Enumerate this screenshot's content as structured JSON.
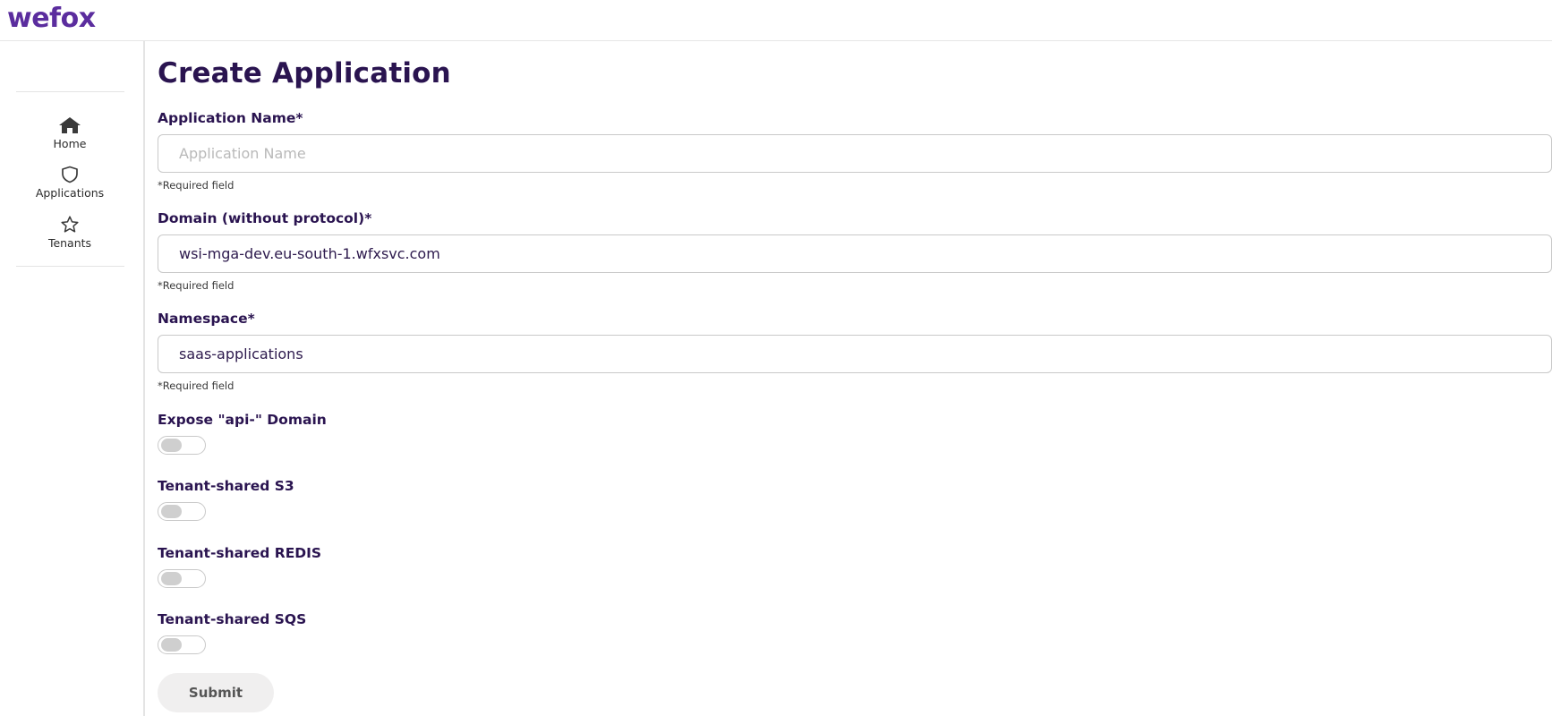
{
  "brand": {
    "logo_text": "wefox",
    "color": "#5b2d9e"
  },
  "sidebar": {
    "items": [
      {
        "label": "Home",
        "icon": "home-icon"
      },
      {
        "label": "Applications",
        "icon": "shield-icon"
      },
      {
        "label": "Tenants",
        "icon": "star-icon"
      }
    ]
  },
  "form": {
    "title": "Create Application",
    "application_name": {
      "label": "Application Name*",
      "placeholder": "Application Name",
      "value": "",
      "help": "*Required field"
    },
    "domain": {
      "label": "Domain (without protocol)*",
      "placeholder": "",
      "value": "wsi-mga-dev.eu-south-1.wfxsvc.com",
      "help": "*Required field"
    },
    "namespace": {
      "label": "Namespace*",
      "placeholder": "",
      "value": "saas-applications",
      "help": "*Required field"
    },
    "toggles": [
      {
        "label": "Expose \"api-\" Domain",
        "checked": false
      },
      {
        "label": "Tenant-shared S3",
        "checked": false
      },
      {
        "label": "Tenant-shared REDIS",
        "checked": false
      },
      {
        "label": "Tenant-shared SQS",
        "checked": false
      }
    ],
    "submit_label": "Submit"
  }
}
